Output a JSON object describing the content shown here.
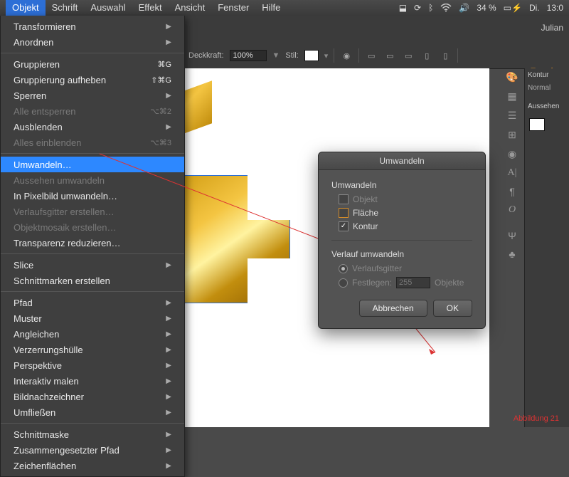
{
  "menubar": {
    "items": [
      "Objekt",
      "Schrift",
      "Auswahl",
      "Effekt",
      "Ansicht",
      "Fenster",
      "Hilfe"
    ],
    "active_index": 0,
    "tray": {
      "battery": "34 %",
      "charging": "⚡",
      "day": "Di.",
      "time": "13:0"
    }
  },
  "subbar": {
    "user": "Julian",
    "opacity_label": "Deckkraft:",
    "opacity_value": "100%",
    "style_label": "Stil:",
    "transform_link": "Transform"
  },
  "dropdown": {
    "groups": [
      [
        {
          "label": "Transformieren",
          "sub": true
        },
        {
          "label": "Anordnen",
          "sub": true
        }
      ],
      [
        {
          "label": "Gruppieren",
          "shortcut": "⌘G"
        },
        {
          "label": "Gruppierung aufheben",
          "shortcut": "⇧⌘G"
        },
        {
          "label": "Sperren",
          "sub": true
        },
        {
          "label": "Alle entsperren",
          "shortcut": "⌥⌘2",
          "disabled": true
        },
        {
          "label": "Ausblenden",
          "sub": true
        },
        {
          "label": "Alles einblenden",
          "shortcut": "⌥⌘3",
          "disabled": true
        }
      ],
      [
        {
          "label": "Umwandeln…",
          "highlight": true
        },
        {
          "label": "Aussehen umwandeln",
          "disabled": true
        },
        {
          "label": "In Pixelbild umwandeln…"
        },
        {
          "label": "Verlaufsgitter erstellen…",
          "disabled": true
        },
        {
          "label": "Objektmosaik erstellen…",
          "disabled": true
        },
        {
          "label": "Transparenz reduzieren…"
        }
      ],
      [
        {
          "label": "Slice",
          "sub": true
        },
        {
          "label": "Schnittmarken erstellen"
        }
      ],
      [
        {
          "label": "Pfad",
          "sub": true
        },
        {
          "label": "Muster",
          "sub": true
        },
        {
          "label": "Angleichen",
          "sub": true
        },
        {
          "label": "Verzerrungshülle",
          "sub": true
        },
        {
          "label": "Perspektive",
          "sub": true
        },
        {
          "label": "Interaktiv malen",
          "sub": true
        },
        {
          "label": "Bildnachzeichner",
          "sub": true
        },
        {
          "label": "Umfließen",
          "sub": true
        }
      ],
      [
        {
          "label": "Schnittmaske",
          "sub": true
        },
        {
          "label": "Zusammengesetzter Pfad",
          "sub": true
        },
        {
          "label": "Zeichenflächen",
          "sub": true
        }
      ]
    ]
  },
  "dialog": {
    "title": "Umwandeln",
    "section1": "Umwandeln",
    "opt_object": "Objekt",
    "opt_fill": "Fläche",
    "opt_stroke": "Kontur",
    "checked_fill": false,
    "checked_stroke": true,
    "section2": "Verlauf umwandeln",
    "opt_mesh": "Verlaufsgitter",
    "opt_specify": "Festlegen:",
    "specify_value": "255",
    "specify_unit": "Objekte",
    "btn_cancel": "Abbrechen",
    "btn_ok": "OK"
  },
  "panels": {
    "kontur": "Kontur",
    "normal": "Normal",
    "aussehen": "Aussehen"
  },
  "annotation": "Abbildung  21"
}
